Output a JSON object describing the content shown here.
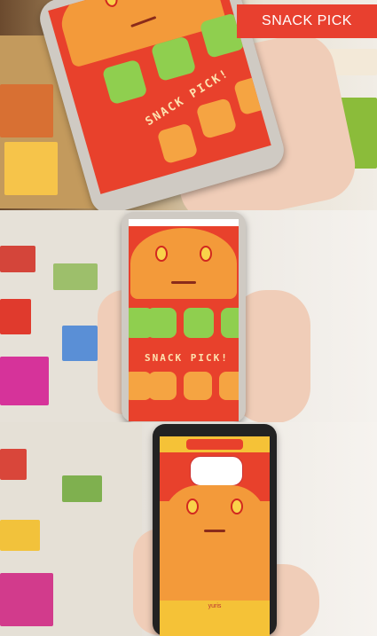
{
  "badge": {
    "text": "SNACK PICK"
  },
  "screen": {
    "title_text": "SNACK PICK!",
    "bottom_label": "yuris"
  },
  "colors": {
    "background_red": "#e8412c",
    "badge_red": "#e8402f",
    "cracker_orange": "#f39a3a",
    "green_biscuit": "#8fcf4f",
    "yellow_bar": "#f5c237"
  }
}
